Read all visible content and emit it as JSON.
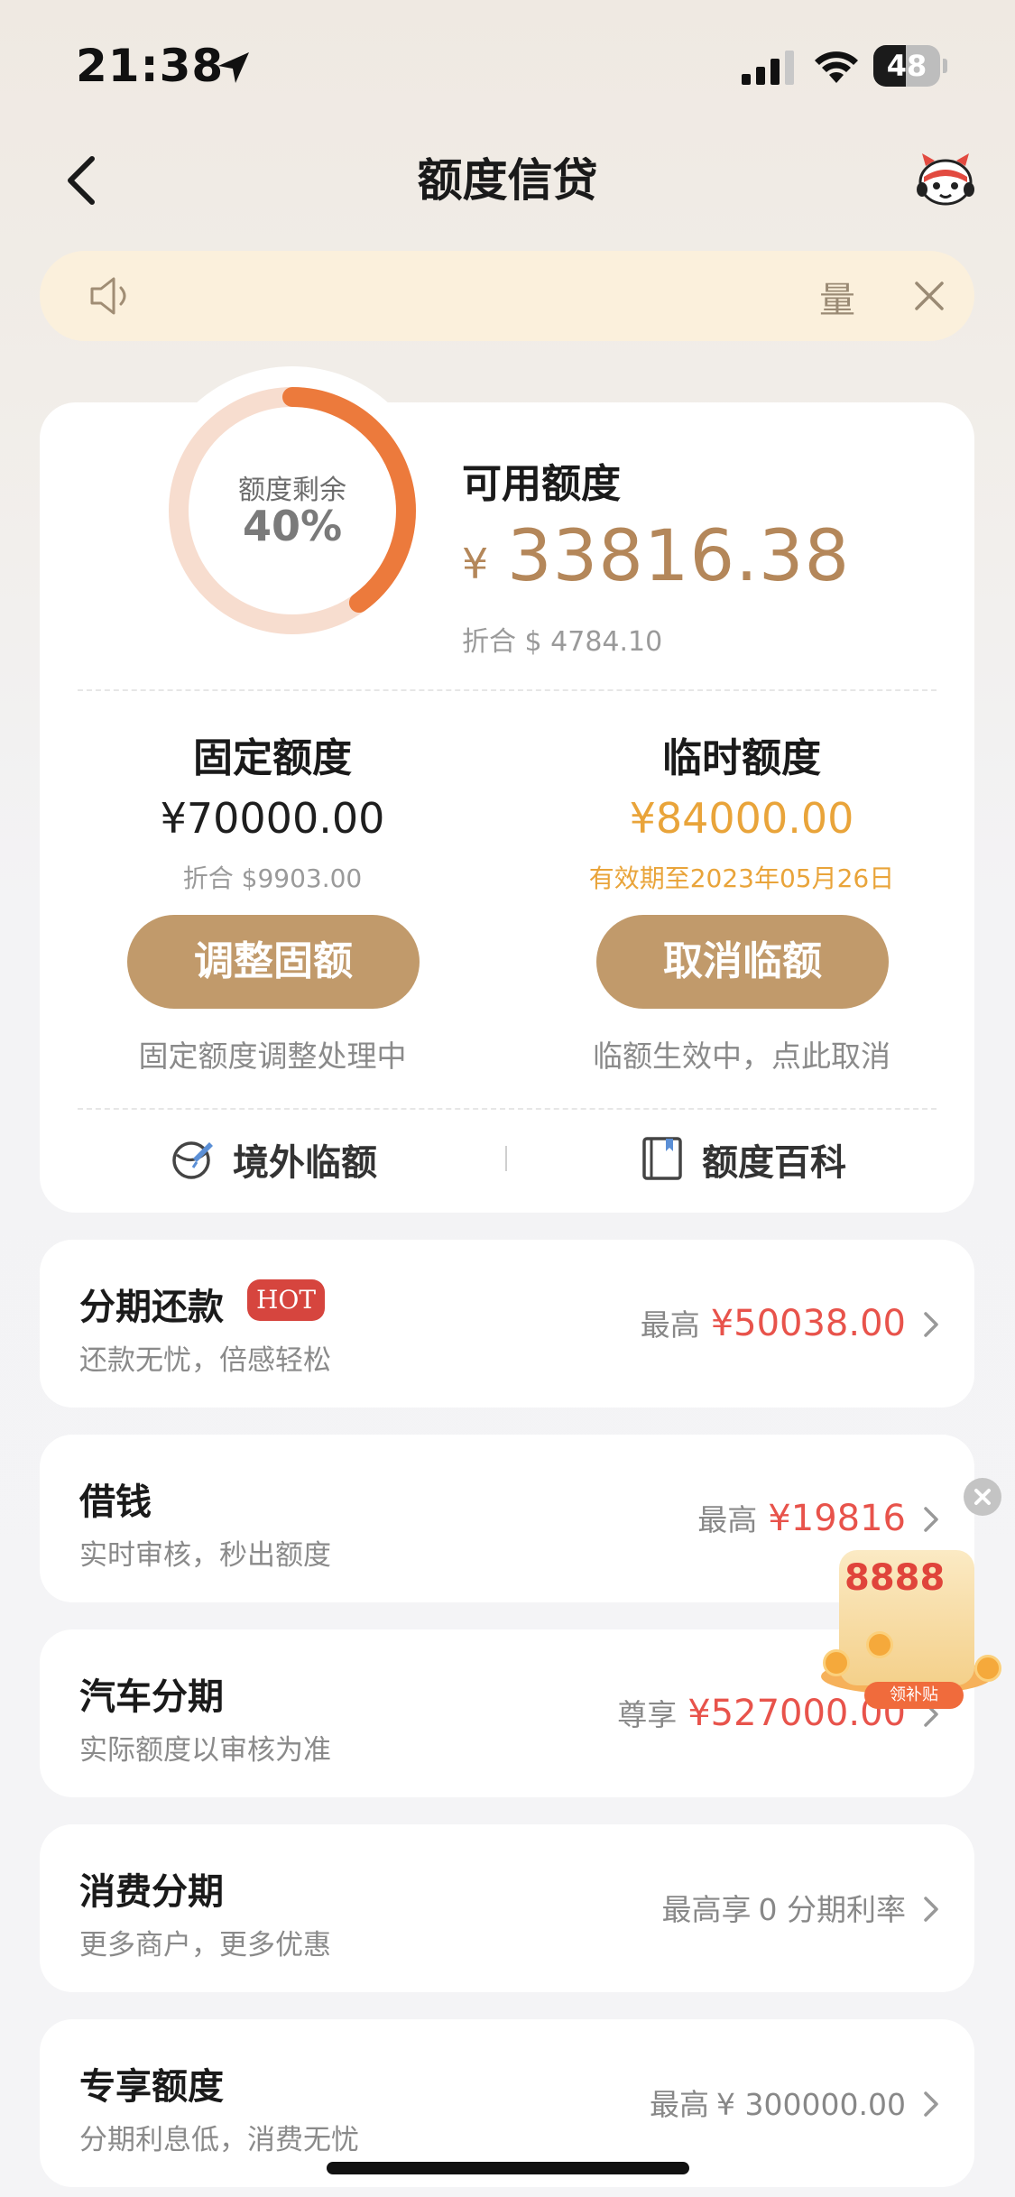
{
  "status_bar": {
    "time": "21:38",
    "battery_percent": 48,
    "battery_text": "48"
  },
  "nav": {
    "title": "额度信贷"
  },
  "notice": {
    "text": "量"
  },
  "quota": {
    "ring_label": "额度剩余",
    "ring_percent_text": "40%",
    "ring_fraction": 0.4,
    "available_label": "可用额度",
    "available_currency": "¥",
    "available_amount": "33816.38",
    "available_equiv": "折合 $ 4784.10",
    "fixed": {
      "title": "固定额度",
      "amount": "¥70000.00",
      "sub": "折合 $9903.00",
      "button": "调整固额",
      "note": "固定额度调整处理中"
    },
    "temp": {
      "title": "临时额度",
      "amount": "¥84000.00",
      "sub": "有效期至2023年05月26日",
      "button": "取消临额",
      "note": "临额生效中，点此取消"
    },
    "links": {
      "overseas": "境外临额",
      "wiki": "额度百科"
    }
  },
  "list": [
    {
      "title": "分期还款",
      "badge": "HOT",
      "sub": "还款无忧，倍感轻松",
      "prefix": "最高",
      "value": "¥50038.00"
    },
    {
      "title": "借钱",
      "sub": "实时审核，秒出额度",
      "prefix": "最高",
      "value": "¥19816"
    },
    {
      "title": "汽车分期",
      "sub": "实际额度以审核为准",
      "prefix": "尊享",
      "value": "¥527000.00"
    },
    {
      "title": "消费分期",
      "sub": "更多商户，更多优惠",
      "prefix": "最高享",
      "value": "0 分期利率"
    },
    {
      "title": "专享额度",
      "sub": "分期利息低，消费无忧",
      "prefix": "最高",
      "value": "¥ 300000.00"
    }
  ],
  "promo": {
    "number": "8888",
    "label": "领补贴"
  },
  "colors": {
    "brand": "#c19a6b",
    "ring": "#ec7a3c",
    "ring_track": "#f7ddcf",
    "red": "#e8534b",
    "orange": "#e9a43a"
  },
  "icons": [
    "location-arrow-icon",
    "signal-icon",
    "wifi-icon",
    "battery-icon",
    "back-chevron-icon",
    "mascot-avatar-icon",
    "speaker-icon",
    "close-icon",
    "globe-plane-icon",
    "book-icon",
    "chevron-right-icon"
  ]
}
